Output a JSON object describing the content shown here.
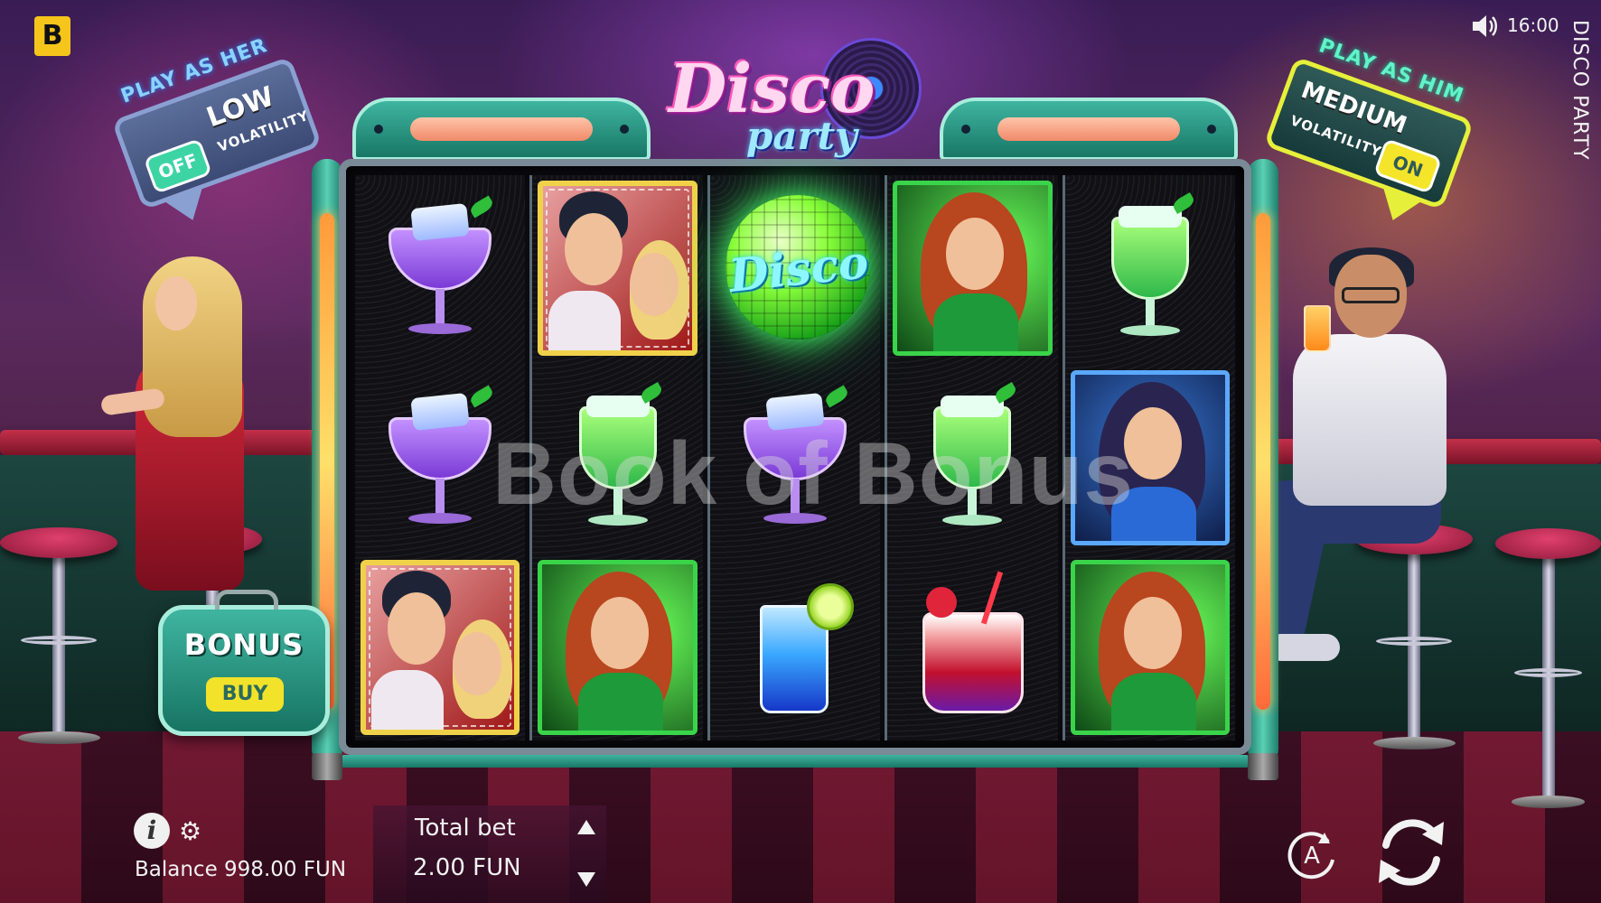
{
  "brand": {
    "logo_letter": "B"
  },
  "status": {
    "time": "16:00",
    "sound_icon": "speaker-icon"
  },
  "game": {
    "title_vertical": "DISCO PARTY",
    "logo_main": "Disco",
    "logo_sub": "party"
  },
  "volatility": {
    "her": {
      "heading": "PLAY AS HER",
      "level": "LOW",
      "word": "VOLATILITY",
      "toggle": "OFF"
    },
    "him": {
      "heading": "PLAY AS HIM",
      "level": "MEDIUM",
      "word": "VOLATILITY",
      "toggle": "ON"
    }
  },
  "reels": [
    [
      "purple-cocktail",
      "purple-cocktail",
      "couple-tile"
    ],
    [
      "couple-tile",
      "green-cocktail",
      "redhead-tile"
    ],
    [
      "disco-wild",
      "purple-cocktail",
      "blue-drink"
    ],
    [
      "redhead-tile",
      "green-cocktail",
      "red-drink"
    ],
    [
      "green-cocktail",
      "brunette-tile",
      "redhead-tile"
    ]
  ],
  "wild_label": "Disco",
  "bonus_buy": {
    "line1": "BONUS",
    "line2": "BUY"
  },
  "footer": {
    "info_label": "i",
    "settings_icon": "gear-icon",
    "balance": "Balance 998.00 FUN",
    "bet_title": "Total bet",
    "bet_value": "2.00 FUN",
    "autoplay_label": "A"
  },
  "watermark": "Book of Bonus",
  "colors": {
    "accent_teal": "#3fb5a0",
    "brand_yellow": "#f5c51b",
    "neon_green": "#3ad44a"
  }
}
